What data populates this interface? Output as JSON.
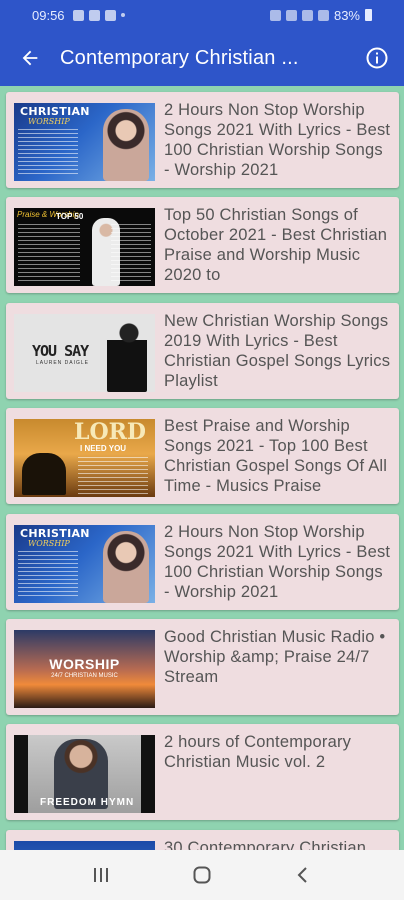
{
  "status_bar": {
    "time": "09:56",
    "battery": "83%"
  },
  "app_bar": {
    "title": "Contemporary Christian ...",
    "back_icon": "arrow-back-icon",
    "info_icon": "info-icon"
  },
  "videos": [
    {
      "title": "2 Hours Non Stop Worship Songs 2021 With Lyrics - Best 100 Christian Worship Songs  - Worship 2021",
      "thumb_text": "CHRISTIAN",
      "thumb_text2": "WORSHIP"
    },
    {
      "title": "Top 50 Christian Songs of October 2021 - Best Christian Praise and Worship Music 2020 to",
      "thumb_text": "Praise & Worship",
      "thumb_text2": "TOP 50"
    },
    {
      "title": "New Christian Worship Songs 2019 With Lyrics - Best Christian Gospel Songs Lyrics Playlist",
      "thumb_text": "YOU SAY",
      "thumb_text2": "LAUREN DAIGLE"
    },
    {
      "title": "Best Praise and Worship Songs 2021 - Top 100 Best Christian Gospel Songs Of All Time - Musics Praise",
      "thumb_text": "LORD",
      "thumb_text2": "I NEED YOU"
    },
    {
      "title": "2 Hours Non Stop Worship Songs 2021 With Lyrics - Best 100 Christian Worship Songs  - Worship 2021",
      "thumb_text": "CHRISTIAN",
      "thumb_text2": "WORSHIP"
    },
    {
      "title": "Good Christian Music Radio • Worship &amp; Praise 24/7 Stream",
      "thumb_text": "WORSHIP",
      "thumb_text2": "24/7 CHRISTIAN MUSIC"
    },
    {
      "title": "2 hours of Contemporary Christian Music vol. 2",
      "thumb_text": "FREEDOM HYMN",
      "thumb_text2": ""
    },
    {
      "title": "30 Contemporary Christian",
      "thumb_text": "",
      "thumb_text2": ""
    }
  ],
  "nav_bar": {
    "recents_icon": "recents-icon",
    "home_icon": "home-icon",
    "back_icon": "nav-back-icon"
  }
}
